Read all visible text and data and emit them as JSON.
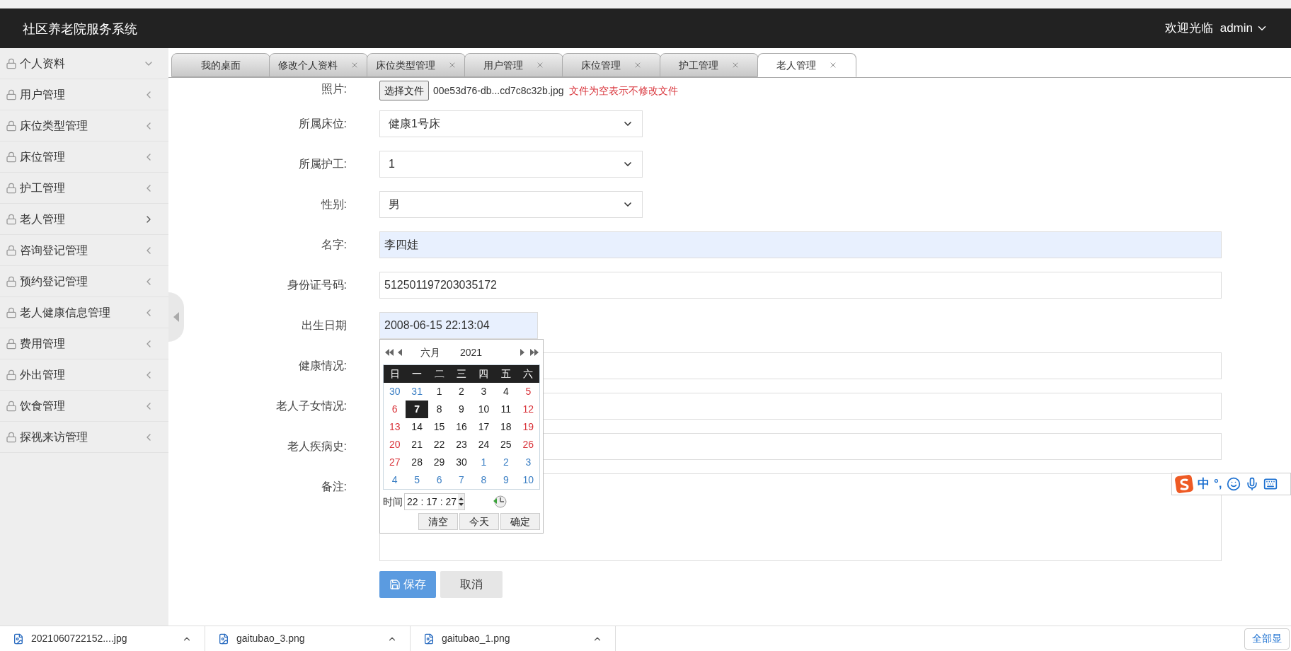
{
  "header": {
    "title": "社区养老院服务系统",
    "welcome": "欢迎光临",
    "user": "admin"
  },
  "sidebar": {
    "items": [
      {
        "label": "个人资料",
        "expanded": true,
        "selected": false
      },
      {
        "label": "用户管理",
        "expanded": false,
        "selected": false
      },
      {
        "label": "床位类型管理",
        "expanded": false,
        "selected": false
      },
      {
        "label": "床位管理",
        "expanded": false,
        "selected": false
      },
      {
        "label": "护工管理",
        "expanded": false,
        "selected": false
      },
      {
        "label": "老人管理",
        "expanded": false,
        "selected": true
      },
      {
        "label": "咨询登记管理",
        "expanded": false,
        "selected": false
      },
      {
        "label": "预约登记管理",
        "expanded": false,
        "selected": false
      },
      {
        "label": "老人健康信息管理",
        "expanded": false,
        "selected": false
      },
      {
        "label": "费用管理",
        "expanded": false,
        "selected": false
      },
      {
        "label": "外出管理",
        "expanded": false,
        "selected": false
      },
      {
        "label": "饮食管理",
        "expanded": false,
        "selected": false
      },
      {
        "label": "探视来访管理",
        "expanded": false,
        "selected": false
      }
    ]
  },
  "tabs": [
    {
      "label": "我的桌面",
      "closable": false,
      "selected": false
    },
    {
      "label": "修改个人资料",
      "closable": true,
      "selected": false
    },
    {
      "label": "床位类型管理",
      "closable": true,
      "selected": false
    },
    {
      "label": "用户管理",
      "closable": true,
      "selected": false
    },
    {
      "label": "床位管理",
      "closable": true,
      "selected": false
    },
    {
      "label": "护工管理",
      "closable": true,
      "selected": false
    },
    {
      "label": "老人管理",
      "closable": true,
      "selected": true
    }
  ],
  "form": {
    "fields": [
      {
        "kind": "file",
        "label": "照片:",
        "button": "选择文件",
        "value": "00e53d76-db...cd7c8c32b.jpg",
        "hint": "文件为空表示不修改文件"
      },
      {
        "kind": "select",
        "label": "所属床位:",
        "value": "健康1号床"
      },
      {
        "kind": "select",
        "label": "所属护工:",
        "value": "1"
      },
      {
        "kind": "select",
        "label": "性别:",
        "value": "男"
      },
      {
        "kind": "text",
        "label": "名字:",
        "value": "李四娃",
        "autofilled": true
      },
      {
        "kind": "text",
        "label": "身份证号码:",
        "value": "512501197203035172",
        "autofilled": false
      },
      {
        "kind": "date",
        "label": "出生日期",
        "value": "2008-06-15 22:13:04",
        "autofilled": true
      },
      {
        "kind": "text",
        "label": "健康情况:",
        "autofilled": false
      },
      {
        "kind": "text",
        "label": "老人子女情况:",
        "autofilled": false
      },
      {
        "kind": "text",
        "label": "老人疾病史:",
        "autofilled": false
      },
      {
        "kind": "textarea",
        "label": "备注:"
      }
    ],
    "save": "保存",
    "cancel": "取消"
  },
  "datepicker": {
    "month": "六月",
    "year": "2021",
    "weekdays": [
      "日",
      "一",
      "二",
      "三",
      "四",
      "五",
      "六"
    ],
    "days": [
      {
        "day": "30",
        "kind": "other",
        "selected": false
      },
      {
        "day": "31",
        "kind": "other",
        "selected": false
      },
      {
        "day": "1",
        "kind": "normal",
        "selected": false
      },
      {
        "day": "2",
        "kind": "normal",
        "selected": false
      },
      {
        "day": "3",
        "kind": "normal",
        "selected": false
      },
      {
        "day": "4",
        "kind": "normal",
        "selected": false
      },
      {
        "day": "5",
        "kind": "weekend",
        "selected": false
      },
      {
        "day": "6",
        "kind": "weekend",
        "selected": false
      },
      {
        "day": "7",
        "kind": "normal",
        "selected": true
      },
      {
        "day": "8",
        "kind": "normal",
        "selected": false
      },
      {
        "day": "9",
        "kind": "normal",
        "selected": false
      },
      {
        "day": "10",
        "kind": "normal",
        "selected": false
      },
      {
        "day": "11",
        "kind": "normal",
        "selected": false
      },
      {
        "day": "12",
        "kind": "weekend",
        "selected": false
      },
      {
        "day": "13",
        "kind": "weekend",
        "selected": false
      },
      {
        "day": "14",
        "kind": "normal",
        "selected": false
      },
      {
        "day": "15",
        "kind": "normal",
        "selected": false
      },
      {
        "day": "16",
        "kind": "normal",
        "selected": false
      },
      {
        "day": "17",
        "kind": "normal",
        "selected": false
      },
      {
        "day": "18",
        "kind": "normal",
        "selected": false
      },
      {
        "day": "19",
        "kind": "weekend",
        "selected": false
      },
      {
        "day": "20",
        "kind": "weekend",
        "selected": false
      },
      {
        "day": "21",
        "kind": "normal",
        "selected": false
      },
      {
        "day": "22",
        "kind": "normal",
        "selected": false
      },
      {
        "day": "23",
        "kind": "normal",
        "selected": false
      },
      {
        "day": "24",
        "kind": "normal",
        "selected": false
      },
      {
        "day": "25",
        "kind": "normal",
        "selected": false
      },
      {
        "day": "26",
        "kind": "weekend",
        "selected": false
      },
      {
        "day": "27",
        "kind": "weekend",
        "selected": false
      },
      {
        "day": "28",
        "kind": "normal",
        "selected": false
      },
      {
        "day": "29",
        "kind": "normal",
        "selected": false
      },
      {
        "day": "30",
        "kind": "normal",
        "selected": false
      },
      {
        "day": "1",
        "kind": "other",
        "selected": false
      },
      {
        "day": "2",
        "kind": "other",
        "selected": false
      },
      {
        "day": "3",
        "kind": "other",
        "selected": false
      },
      {
        "day": "4",
        "kind": "other",
        "selected": false
      },
      {
        "day": "5",
        "kind": "other",
        "selected": false
      },
      {
        "day": "6",
        "kind": "other",
        "selected": false
      },
      {
        "day": "7",
        "kind": "other",
        "selected": false
      },
      {
        "day": "8",
        "kind": "other",
        "selected": false
      },
      {
        "day": "9",
        "kind": "other",
        "selected": false
      },
      {
        "day": "10",
        "kind": "other",
        "selected": false
      }
    ],
    "time_label": "时间",
    "time": "22 : 17 : 27",
    "buttons": [
      "清空",
      "今天",
      "确定"
    ]
  },
  "ime": {
    "mode": "中",
    "punct": "°,"
  },
  "downloads": {
    "items": [
      "2021060722152....jpg",
      "gaitubao_3.png",
      "gaitubao_1.png"
    ],
    "show_all": "全部显"
  }
}
